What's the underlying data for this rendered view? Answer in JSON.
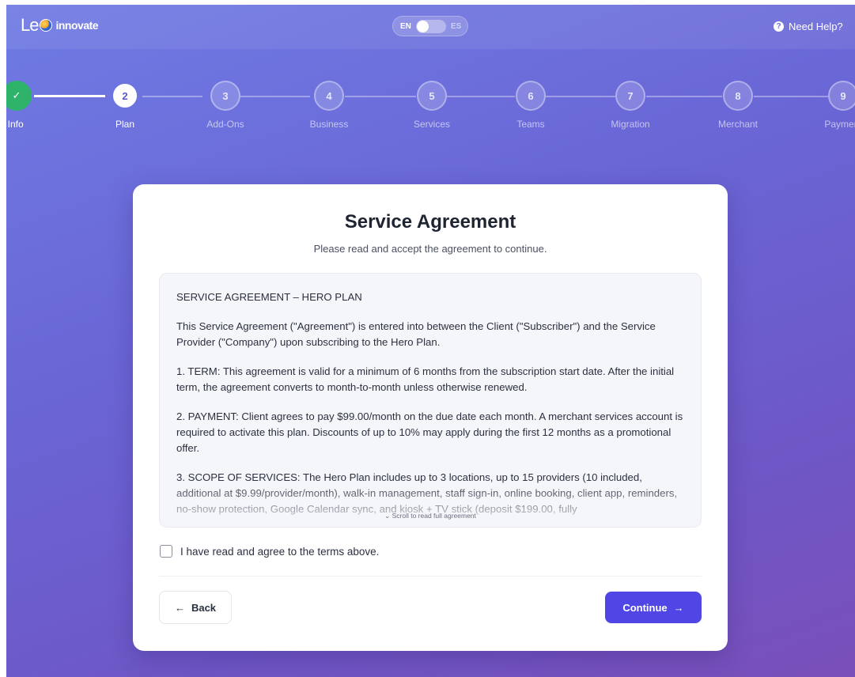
{
  "header": {
    "logo_le": "Le",
    "logo_word": "innovate",
    "lang_en": "EN",
    "lang_es": "ES",
    "help_label": "Need Help?"
  },
  "stepper": {
    "steps": [
      {
        "num": "✓",
        "label": "Owner Info",
        "state": "done"
      },
      {
        "num": "2",
        "label": "Plan",
        "state": "active"
      },
      {
        "num": "3",
        "label": "Add-Ons",
        "state": "pending"
      },
      {
        "num": "4",
        "label": "Business",
        "state": "pending"
      },
      {
        "num": "5",
        "label": "Services",
        "state": "pending"
      },
      {
        "num": "6",
        "label": "Teams",
        "state": "pending"
      },
      {
        "num": "7",
        "label": "Migration",
        "state": "pending"
      },
      {
        "num": "8",
        "label": "Merchant",
        "state": "pending"
      },
      {
        "num": "9",
        "label": "Payment",
        "state": "pending"
      }
    ]
  },
  "card": {
    "title": "Service Agreement",
    "subtitle": "Please read and accept the agreement to continue.",
    "agreement": {
      "heading": "SERVICE AGREEMENT – HERO PLAN",
      "p1": "This Service Agreement (\"Agreement\") is entered into between the Client (\"Subscriber\") and the Service Provider (\"Company\") upon subscribing to the Hero Plan.",
      "p2": "1. TERM: This agreement is valid for a minimum of 6 months from the subscription start date. After the initial term, the agreement converts to month-to-month unless otherwise renewed.",
      "p3": "2. PAYMENT: Client agrees to pay $99.00/month on the due date each month. A merchant services account is required to activate this plan. Discounts of up to 10% may apply during the first 12 months as a promotional offer.",
      "p4": "3. SCOPE OF SERVICES: The Hero Plan includes up to 3 locations, up to 15 providers (10 included, additional at $9.99/provider/month), walk-in management, staff sign-in, online booking, client app, reminders, no-show protection, Google Calendar sync, and kiosk + TV stick (deposit $199.00, fully",
      "scroll_hint": "Scroll to read full agreement"
    },
    "checkbox_label": "I have read and agree to the terms above.",
    "checkbox_checked": false,
    "back_label": "Back",
    "continue_label": "Continue"
  }
}
